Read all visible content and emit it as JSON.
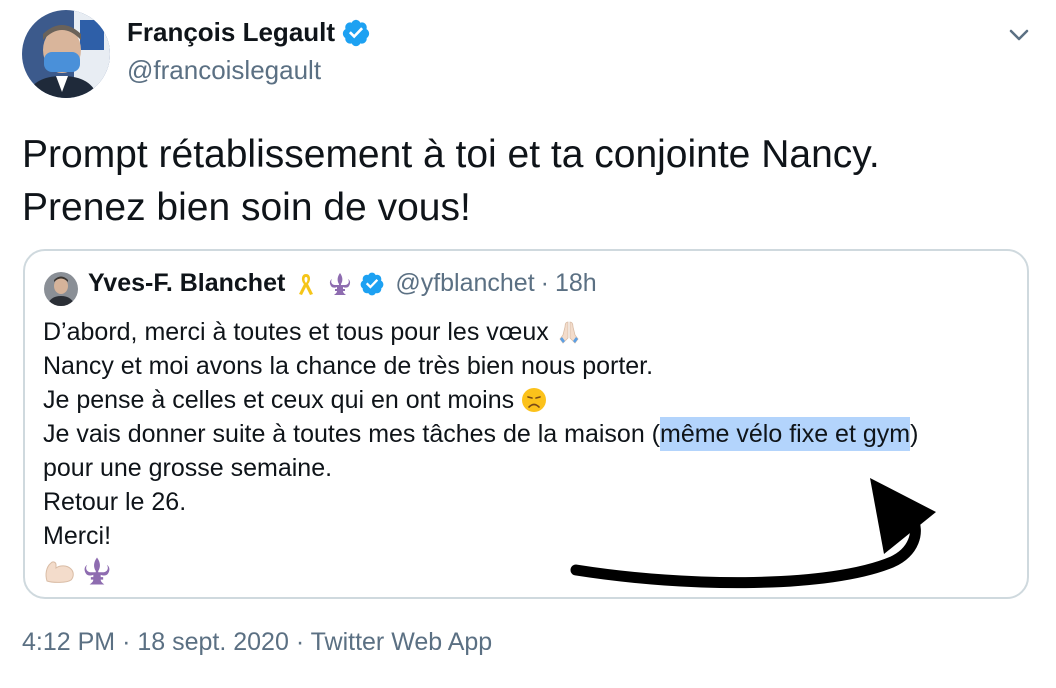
{
  "author": {
    "name": "François Legault",
    "handle": "@francoislegault",
    "avatar_icon": "profile-photo-masked"
  },
  "tweet": {
    "lines": [
      "Prompt rétablissement à toi et ta conjointe Nancy.",
      "Prenez bien soin de vous!"
    ]
  },
  "quote": {
    "name": "Yves-F. Blanchet",
    "name_emojis": [
      "yellow-ribbon-emoji",
      "fleur-de-lis-emoji"
    ],
    "handle": "@yfblanchet",
    "separator": "·",
    "time": "18h",
    "line1": "D’abord, merci à toutes et tous pour les vœux",
    "line1_emoji": "folded-hands-emoji",
    "line2": "Nancy et moi avons la chance de très bien nous porter.",
    "line3": "Je pense à celles et ceux qui en ont moins",
    "line3_emoji": "disappointed-face-emoji",
    "line4_before": "Je vais donner suite à toutes mes tâches de la maison (",
    "line4_highlight": "même vélo fixe et gym",
    "line4_after": ")",
    "line5": "pour une grosse semaine.",
    "line6": "Retour le 26.",
    "line7": "Merci!",
    "final_emojis": [
      "flexed-biceps-emoji",
      "fleur-de-lis-emoji"
    ]
  },
  "footer": {
    "time": "4:12 PM",
    "sep1": "·",
    "date": "18 sept. 2020",
    "sep2": "·",
    "source": "Twitter Web App"
  },
  "colors": {
    "verified_blue": "#1da1f2",
    "secondary_text": "#5b7083",
    "highlight": "#b3d4fc",
    "border": "#cfd9de"
  }
}
